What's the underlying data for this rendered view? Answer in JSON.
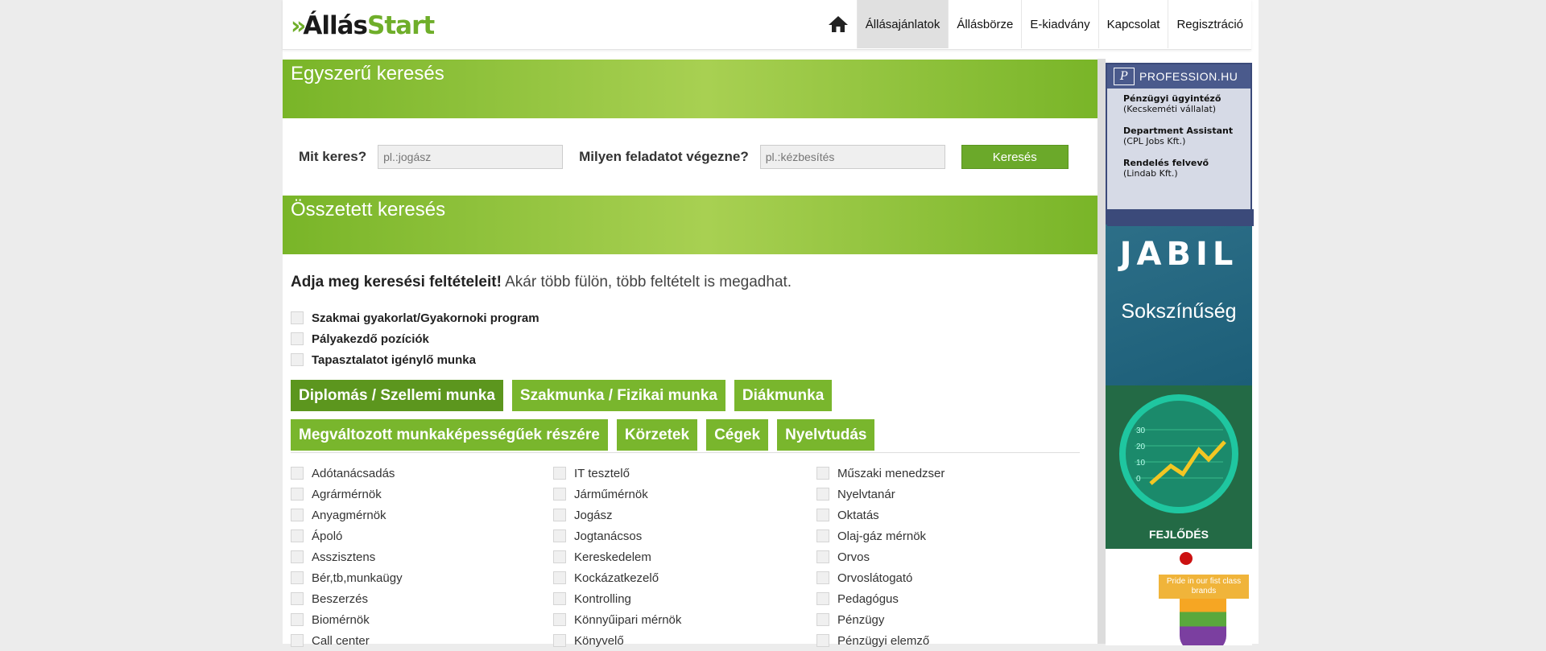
{
  "header": {
    "logo_chevron": "»",
    "logo_part1": "Állás",
    "logo_part2": "Start",
    "nav": [
      "Állásajánlatok",
      "Állásbörze",
      "E-kiadvány",
      "Kapcsolat",
      "Regisztráció"
    ]
  },
  "simple_search": {
    "title": "Egyszerű keresés",
    "what_label": "Mit keres?",
    "what_placeholder": "pl.:jogász",
    "task_label": "Milyen feladatot végezne?",
    "task_placeholder": "pl.:kézbesítés",
    "button": "Keresés"
  },
  "advanced_search": {
    "title": "Összetett keresés",
    "intro_bold": "Adja meg keresési feltételeit!",
    "intro_rest": "Akár több fülön, több feltételt is megadhat.",
    "options": [
      "Szakmai gyakorlat/Gyakornoki program",
      "Pályakezdő pozíciók",
      "Tapasztalatot igénylő munka"
    ],
    "tabs": [
      "Diplomás / Szellemi munka",
      "Szakmunka / Fizikai munka",
      "Diákmunka",
      "Megváltozott munkaképességűek részére",
      "Körzetek",
      "Cégek",
      "Nyelvtudás"
    ],
    "col1": [
      "Adótanácsadás",
      "Agrármérnök",
      "Anyagmérnök",
      "Ápoló",
      "Asszisztens",
      "Bér,tb,munkaügy",
      "Beszerzés",
      "Biomérnök",
      "Call center"
    ],
    "col2": [
      "IT tesztelő",
      "Járműmérnök",
      "Jogász",
      "Jogtanácsos",
      "Kereskedelem",
      "Kockázatkezelő",
      "Kontrolling",
      "Könnyűipari mérnök",
      "Könyvelő"
    ],
    "col3": [
      "Műszaki menedzser",
      "Nyelvtanár",
      "Oktatás",
      "Olaj-gáz mérnök",
      "Orvos",
      "Orvoslátogató",
      "Pedagógus",
      "Pénzügy",
      "Pénzügyi elemző"
    ]
  },
  "sidebar": {
    "profession_brand": "PROFESSION.HU",
    "profession_logo_letter": "P",
    "jobs": [
      {
        "title": "Pénzügyi ügyintéző",
        "company": "(Kecskeméti vállalat)"
      },
      {
        "title": "Department Assistant",
        "company": "(CPL Jobs Kft.)"
      },
      {
        "title": "Rendelés felvevő",
        "company": "(Lindab Kft.)"
      }
    ],
    "jabil_brand": "JABIL",
    "jabil_slogan": "Sokszínűség",
    "growth_caption": "FEJLŐDÉS",
    "growth_ticks": [
      "30",
      "20",
      "10",
      "0"
    ],
    "drink_tag": "Pride in our fist class brands"
  }
}
